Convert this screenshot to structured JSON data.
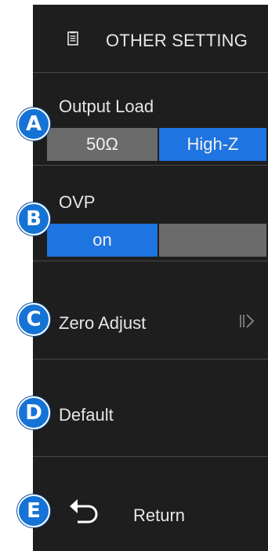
{
  "header": {
    "title": "OTHER SETTING",
    "icon": "document-icon"
  },
  "output_load": {
    "label": "Output Load",
    "options": [
      "50Ω",
      "High-Z"
    ],
    "selected": "High-Z"
  },
  "ovp": {
    "label": "OVP",
    "options": [
      "on",
      ""
    ],
    "selected": "on"
  },
  "zero_adjust": {
    "label": "Zero Adjust",
    "icon": "submenu-arrow-icon"
  },
  "default": {
    "label": "Default"
  },
  "return": {
    "label": "Return",
    "icon": "return-icon"
  },
  "badges": [
    "A",
    "B",
    "C",
    "D",
    "E"
  ],
  "colors": {
    "accent": "#1e74e0",
    "panel": "#1e1e1e",
    "inactive": "#6b6b6b",
    "badge": "#1573d6"
  }
}
